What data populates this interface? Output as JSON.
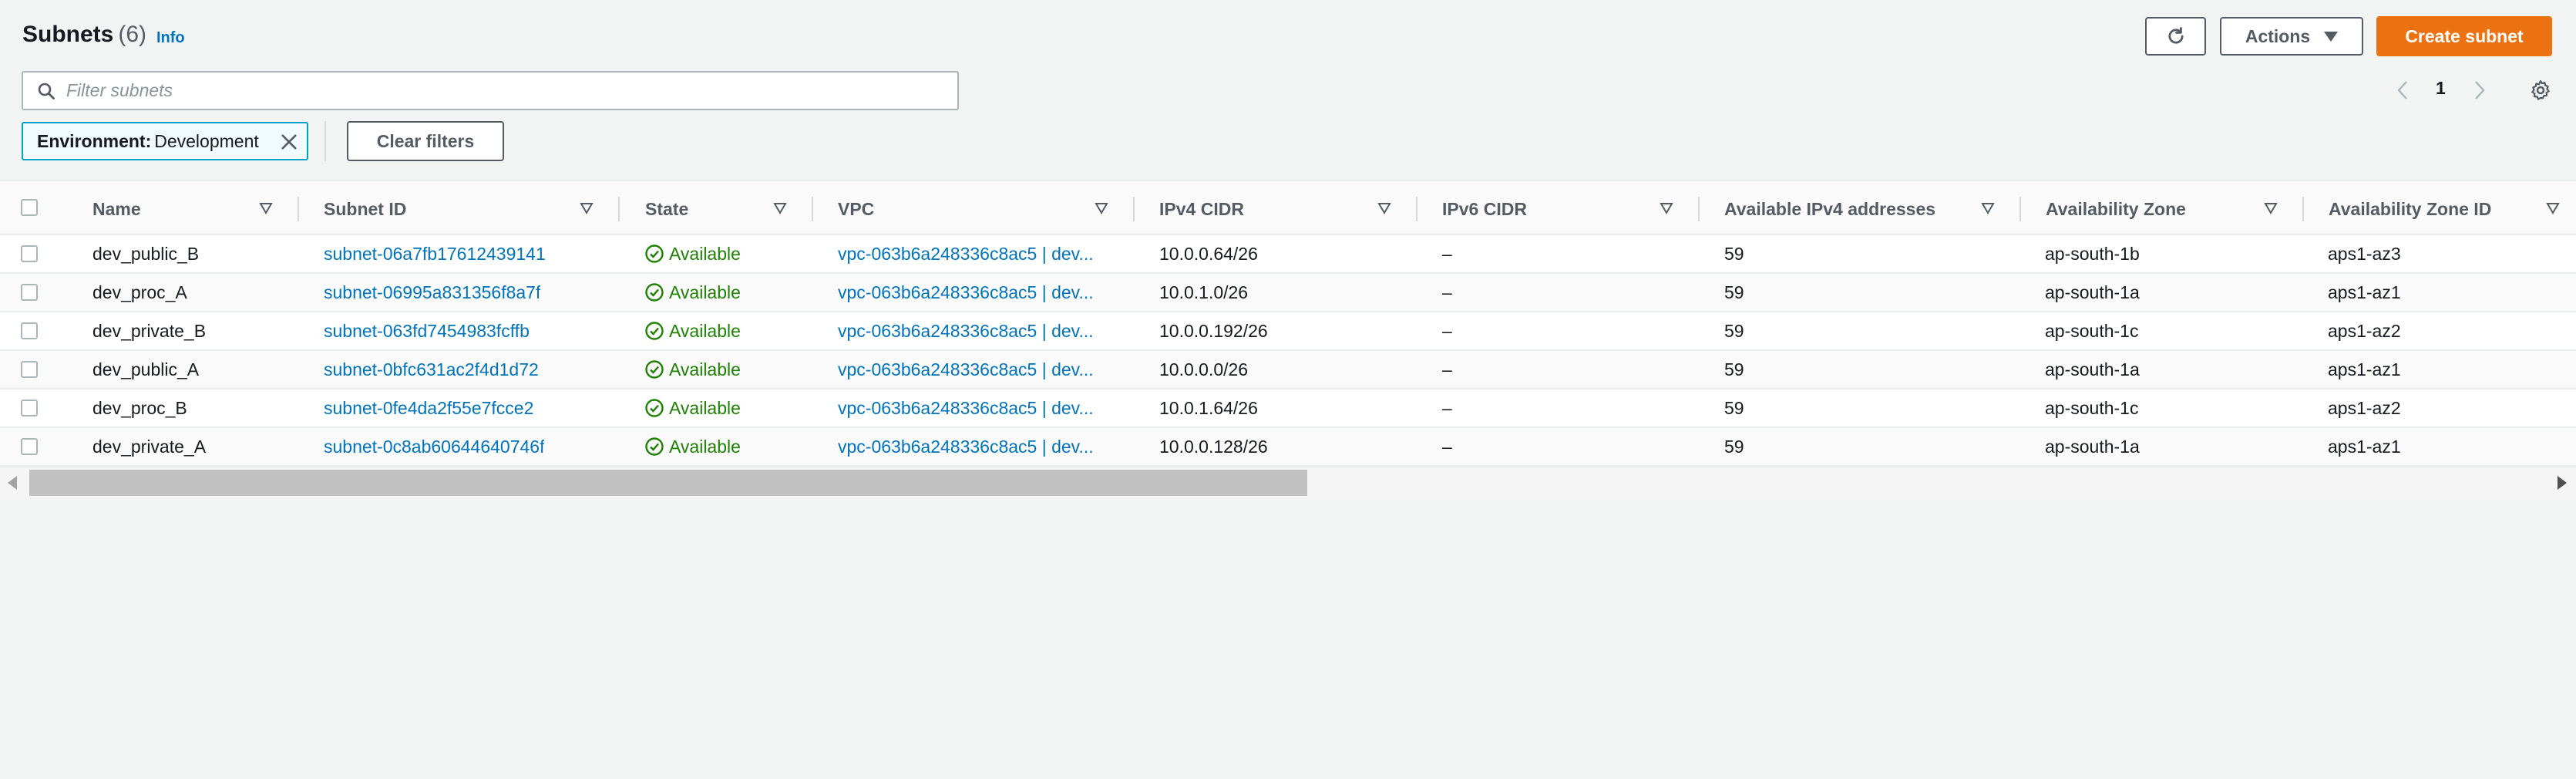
{
  "header": {
    "title": "Subnets",
    "count": "(6)",
    "info": "Info",
    "refresh_icon": "refresh-icon",
    "actions_label": "Actions",
    "create_label": "Create subnet"
  },
  "search": {
    "placeholder": "Filter subnets",
    "value": ""
  },
  "pagination": {
    "current_page": "1"
  },
  "filter": {
    "key": "Environment:",
    "value": "Development",
    "clear_label": "Clear filters"
  },
  "table": {
    "columns": [
      "Name",
      "Subnet ID",
      "State",
      "VPC",
      "IPv4 CIDR",
      "IPv6 CIDR",
      "Available IPv4 addresses",
      "Availability Zone",
      "Availability Zone ID"
    ],
    "rows": [
      {
        "name": "dev_public_B",
        "subnet_id": "subnet-06a7fb17612439141",
        "state": "Available",
        "vpc": "vpc-063b6a248336c8ac5 | dev...",
        "ipv4": "10.0.0.64/26",
        "ipv6": "–",
        "available": "59",
        "az": "ap-south-1b",
        "az_id": "aps1-az3"
      },
      {
        "name": "dev_proc_A",
        "subnet_id": "subnet-06995a831356f8a7f",
        "state": "Available",
        "vpc": "vpc-063b6a248336c8ac5 | dev...",
        "ipv4": "10.0.1.0/26",
        "ipv6": "–",
        "available": "59",
        "az": "ap-south-1a",
        "az_id": "aps1-az1"
      },
      {
        "name": "dev_private_B",
        "subnet_id": "subnet-063fd7454983fcffb",
        "state": "Available",
        "vpc": "vpc-063b6a248336c8ac5 | dev...",
        "ipv4": "10.0.0.192/26",
        "ipv6": "–",
        "available": "59",
        "az": "ap-south-1c",
        "az_id": "aps1-az2"
      },
      {
        "name": "dev_public_A",
        "subnet_id": "subnet-0bfc631ac2f4d1d72",
        "state": "Available",
        "vpc": "vpc-063b6a248336c8ac5 | dev...",
        "ipv4": "10.0.0.0/26",
        "ipv6": "–",
        "available": "59",
        "az": "ap-south-1a",
        "az_id": "aps1-az1"
      },
      {
        "name": "dev_proc_B",
        "subnet_id": "subnet-0fe4da2f55e7fcce2",
        "state": "Available",
        "vpc": "vpc-063b6a248336c8ac5 | dev...",
        "ipv4": "10.0.1.64/26",
        "ipv6": "–",
        "available": "59",
        "az": "ap-south-1c",
        "az_id": "aps1-az2"
      },
      {
        "name": "dev_private_A",
        "subnet_id": "subnet-0c8ab60644640746f",
        "state": "Available",
        "vpc": "vpc-063b6a248336c8ac5 | dev...",
        "ipv4": "10.0.0.128/26",
        "ipv6": "–",
        "available": "59",
        "az": "ap-south-1a",
        "az_id": "aps1-az1"
      }
    ]
  },
  "colors": {
    "accent": "#ec7211",
    "link": "#0073bb",
    "success": "#1d8102",
    "filter_border": "#00a1c9"
  }
}
